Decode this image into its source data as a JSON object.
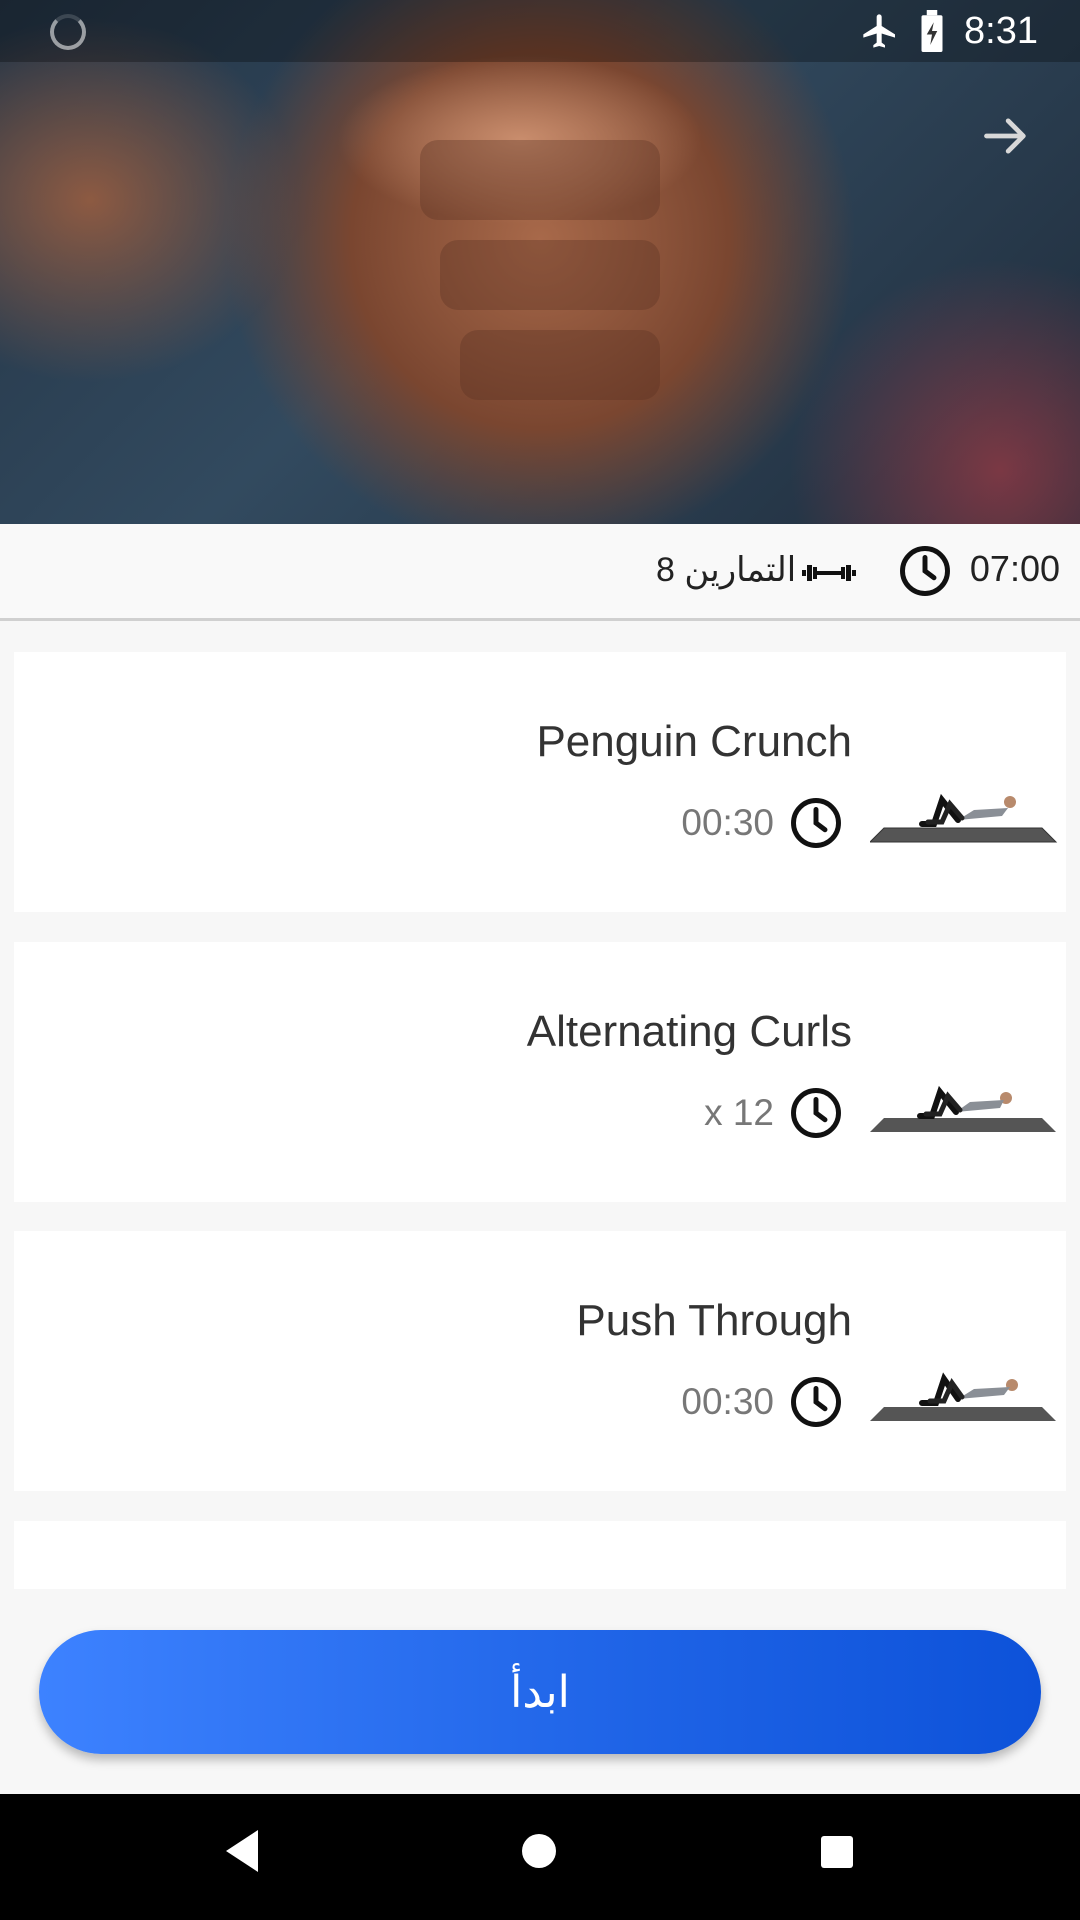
{
  "status_bar": {
    "time": "8:31",
    "icons": [
      "airplane-icon",
      "battery-charging-icon"
    ]
  },
  "hero": {
    "image": "muscular-torso-photo",
    "nav_icon": "arrow-forward-icon"
  },
  "workout_info": {
    "exercise_count_label": "8 التمارين",
    "duration": "07:00"
  },
  "exercises": [
    {
      "name": "Penguin Crunch",
      "value": "00:30"
    },
    {
      "name": "Alternating Curls",
      "value": "x 12"
    },
    {
      "name": "Push Through",
      "value": "00:30"
    }
  ],
  "start_button": {
    "label": "ابدأ"
  },
  "colors": {
    "accent_start": "#3d82ff",
    "accent_end": "#0d52d9"
  },
  "nav": {
    "icons": [
      "back-icon",
      "home-icon",
      "recents-icon"
    ]
  }
}
